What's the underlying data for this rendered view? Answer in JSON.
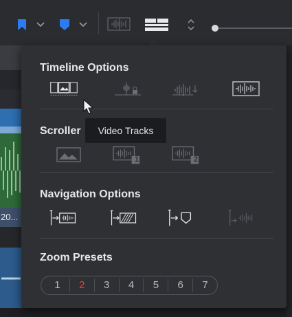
{
  "panel": {
    "sections": [
      {
        "title": "Timeline Options"
      },
      {
        "title": "Scroller"
      },
      {
        "title": "Navigation Options"
      },
      {
        "title": "Zoom Presets"
      }
    ]
  },
  "tooltip": {
    "text": "Video Tracks"
  },
  "background": {
    "clip_text": "20..."
  },
  "zoom_presets": {
    "items": [
      "1",
      "2",
      "3",
      "4",
      "5",
      "6",
      "7"
    ],
    "selected": "2"
  },
  "scroller_badges": {
    "one": "1",
    "two": "2"
  },
  "colors": {
    "accent_blue": "#2d7bf0",
    "selected_red": "#e5413b",
    "panel_bg": "#2f3034"
  }
}
